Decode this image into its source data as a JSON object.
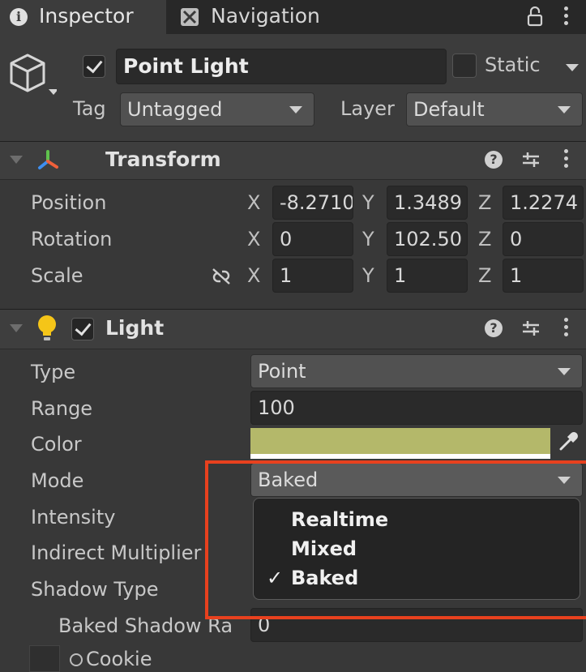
{
  "tabs": [
    {
      "label": "Inspector",
      "icon": "info-icon"
    },
    {
      "label": "Navigation",
      "icon": "navigation-icon"
    }
  ],
  "object": {
    "enabled": true,
    "name": "Point Light",
    "static_label": "Static",
    "static": false,
    "tag_label": "Tag",
    "tag": "Untagged",
    "layer_label": "Layer",
    "layer": "Default"
  },
  "transform": {
    "title": "Transform",
    "rows": [
      {
        "label": "Position",
        "x": "-8.2710",
        "y": "1.3489",
        "z": "1.2274"
      },
      {
        "label": "Rotation",
        "x": "0",
        "y": "102.50",
        "z": "0"
      },
      {
        "label": "Scale",
        "x": "1",
        "y": "1",
        "z": "1"
      }
    ],
    "axes": [
      "X",
      "Y",
      "Z"
    ]
  },
  "light": {
    "title": "Light",
    "enabled": true,
    "type_label": "Type",
    "type": "Point",
    "range_label": "Range",
    "range": "100",
    "color_label": "Color",
    "color": "#b4b86a",
    "mode_label": "Mode",
    "mode": "Baked",
    "intensity_label": "Intensity",
    "indirect_label": "Indirect Multiplier",
    "shadow_type_label": "Shadow Type",
    "baked_shadow_label": "Baked Shadow Ra",
    "baked_shadow_value": "0",
    "cookie_label": "Cookie"
  },
  "mode_menu": {
    "options": [
      "Realtime",
      "Mixed",
      "Baked"
    ],
    "selected": "Baked",
    "check_glyph": "✓"
  },
  "colors": {
    "accent_highlight": "#e8411e",
    "light_bulb": "#f5c518"
  }
}
